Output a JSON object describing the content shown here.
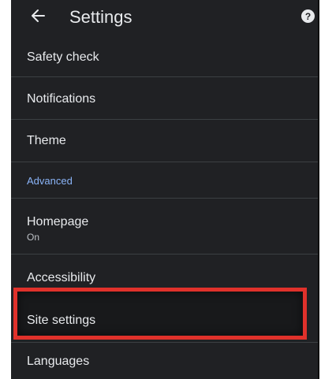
{
  "header": {
    "title": "Settings",
    "back_icon": "arrow-left-icon",
    "help_icon": "help-icon"
  },
  "settings": {
    "safety_check": "Safety check",
    "notifications": "Notifications",
    "theme": "Theme",
    "advanced_header": "Advanced",
    "homepage": {
      "label": "Homepage",
      "status": "On"
    },
    "accessibility": "Accessibility",
    "site_settings": "Site settings",
    "languages": "Languages"
  },
  "colors": {
    "background": "#202124",
    "text": "#e8eaed",
    "accent": "#8ab4f8",
    "highlight_border": "#e0312b"
  }
}
